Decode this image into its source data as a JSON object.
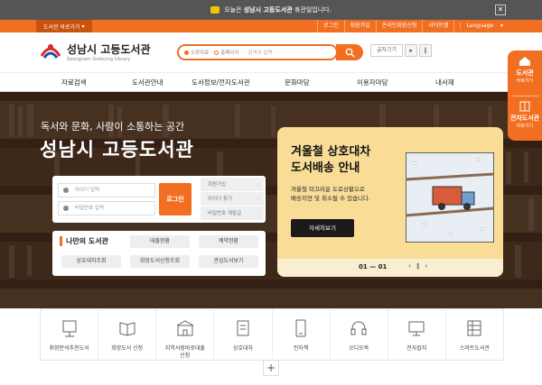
{
  "notice": {
    "prefix": "오늘은",
    "library": "성남시 고등도서관",
    "suffix": "휴관일입니다."
  },
  "util": {
    "shortcut": "도서관 바로가기",
    "links": [
      "로그인",
      "회원가입",
      "온라인회원신청",
      "사이트맵",
      "Language"
    ]
  },
  "logo": {
    "title": "성남시 고등도서관",
    "subtitle": "Seongnam Godeung Library"
  },
  "search": {
    "radio1": "소장자료",
    "radio2": "홈페이지",
    "placeholder": "검색어 입력"
  },
  "zoom": {
    "label": "글자크기"
  },
  "gnb": [
    "자료검색",
    "도서관안내",
    "도서정보/전자도서관",
    "문화마당",
    "이용자마당",
    "내서재"
  ],
  "hero": {
    "slogan": "독서와 문화, 사람이 소통하는 공간",
    "title": "성남시 고등도서관"
  },
  "login": {
    "id_placeholder": "아이디 입력",
    "pw_placeholder": "비밀번호 입력",
    "button": "로그인",
    "side": [
      "회원가입",
      "아이디 찾기",
      "비밀번호 재발급"
    ]
  },
  "mylib": {
    "title": "나만의 도서관",
    "items": [
      "대출현황",
      "예약현황",
      "상호대차조회",
      "희망도서신청조회",
      "관심도서보기"
    ]
  },
  "banner": {
    "title_line1": "겨울철 상호대차",
    "title_line2": "도서배송 안내",
    "desc_line1": "겨울철 미끄러운 도로상황으로",
    "desc_line2": "배송지연 및 취소될 수 있습니다.",
    "more": "자세히보기",
    "page": "01 — 01",
    "colors": {
      "background": "#f9dd97",
      "accent": "#f26f21"
    }
  },
  "quick": [
    {
      "icon": "book-stand-icon",
      "label": "취향분석추천도서"
    },
    {
      "icon": "book-request-icon",
      "label": "희망도서 신청"
    },
    {
      "icon": "local-bookstore-icon",
      "label": "지역서점바로대출\n신청"
    },
    {
      "icon": "interlibrary-loan-icon",
      "label": "상호대차"
    },
    {
      "icon": "ebook-icon",
      "label": "전자책"
    },
    {
      "icon": "audiobook-icon",
      "label": "오디오북"
    },
    {
      "icon": "e-magazine-icon",
      "label": "전자잡지"
    },
    {
      "icon": "smart-library-icon",
      "label": "스마트도서관"
    }
  ],
  "floating": [
    {
      "title": "도서관",
      "sub": "바로가기"
    },
    {
      "title": "전자도서관",
      "sub": "바로가기"
    }
  ],
  "theme": {
    "accent": "#f26f21",
    "dark": "#555555"
  }
}
